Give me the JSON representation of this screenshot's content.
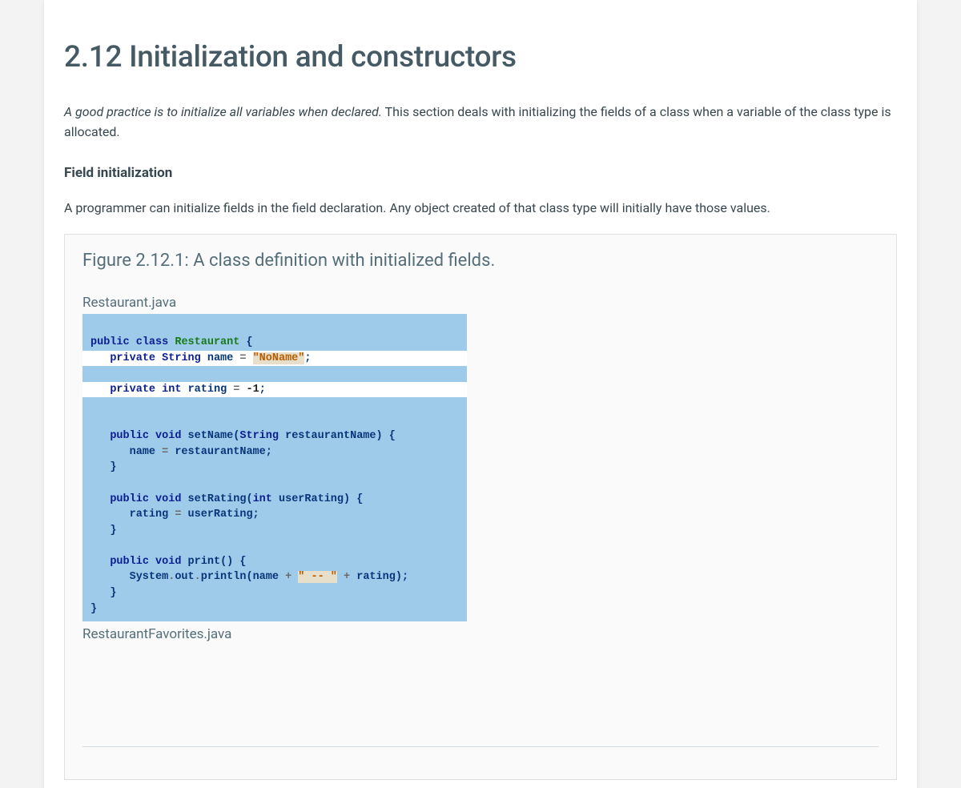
{
  "title": "2.12 Initialization and constructors",
  "intro_italic": "A good practice is to initialize all variables when declared.",
  "intro_rest": " This section deals with initializing the fields of a class when a variable of the class type is allocated.",
  "subheading": "Field initialization",
  "body": "A programmer can initialize fields in the field declaration. Any object created of that class type will initially have those values.",
  "figure": {
    "title": "Figure 2.12.1: A class definition with initialized fields.",
    "file1_label": "Restaurant.java",
    "file2_label": "RestaurantFavorites.java",
    "code": {
      "l1_kw1": "public",
      "l1_kw2": "class",
      "l1_class": "Restaurant",
      "l1_brace": " {",
      "l2_kw": "private",
      "l2_type": "String",
      "l2_name": "name",
      "l2_eq": " = ",
      "l2_str": "\"NoName\"",
      "l2_semi": ";",
      "l3_kw": "private",
      "l3_type": "int",
      "l3_name": "rating",
      "l3_eq": " = ",
      "l3_val": "-1",
      "l3_semi": ";",
      "l5_kw1": "public",
      "l5_kw2": "void",
      "l5_fn": "setName",
      "l5_open": "(",
      "l5_ptype": "String",
      "l5_pname": "restaurantName",
      "l5_close": ")",
      "l5_brace": " {",
      "l6_lhs": "name",
      "l6_eq": " = ",
      "l6_rhs": "restaurantName",
      "l6_semi": ";",
      "l7_brace": "}",
      "l9_kw1": "public",
      "l9_kw2": "void",
      "l9_fn": "setRating",
      "l9_open": "(",
      "l9_ptype": "int",
      "l9_pname": "userRating",
      "l9_close": ")",
      "l9_brace": " {",
      "l10_lhs": "rating",
      "l10_eq": " = ",
      "l10_rhs": "userRating",
      "l10_semi": ";",
      "l11_brace": "}",
      "l13_kw1": "public",
      "l13_kw2": "void",
      "l13_fn": "print",
      "l13_parens": "()",
      "l13_brace": " {",
      "l14_sys": "System",
      "l14_dot1": ".",
      "l14_out": "out",
      "l14_dot2": ".",
      "l14_println": "println",
      "l14_open": "(",
      "l14_arg1": "name",
      "l14_plus1": " + ",
      "l14_str": "\" -- \"",
      "l14_plus2": " + ",
      "l14_arg2": "rating",
      "l14_close": ")",
      "l14_semi": ";",
      "l15_brace": "}",
      "l16_brace": "}"
    }
  }
}
